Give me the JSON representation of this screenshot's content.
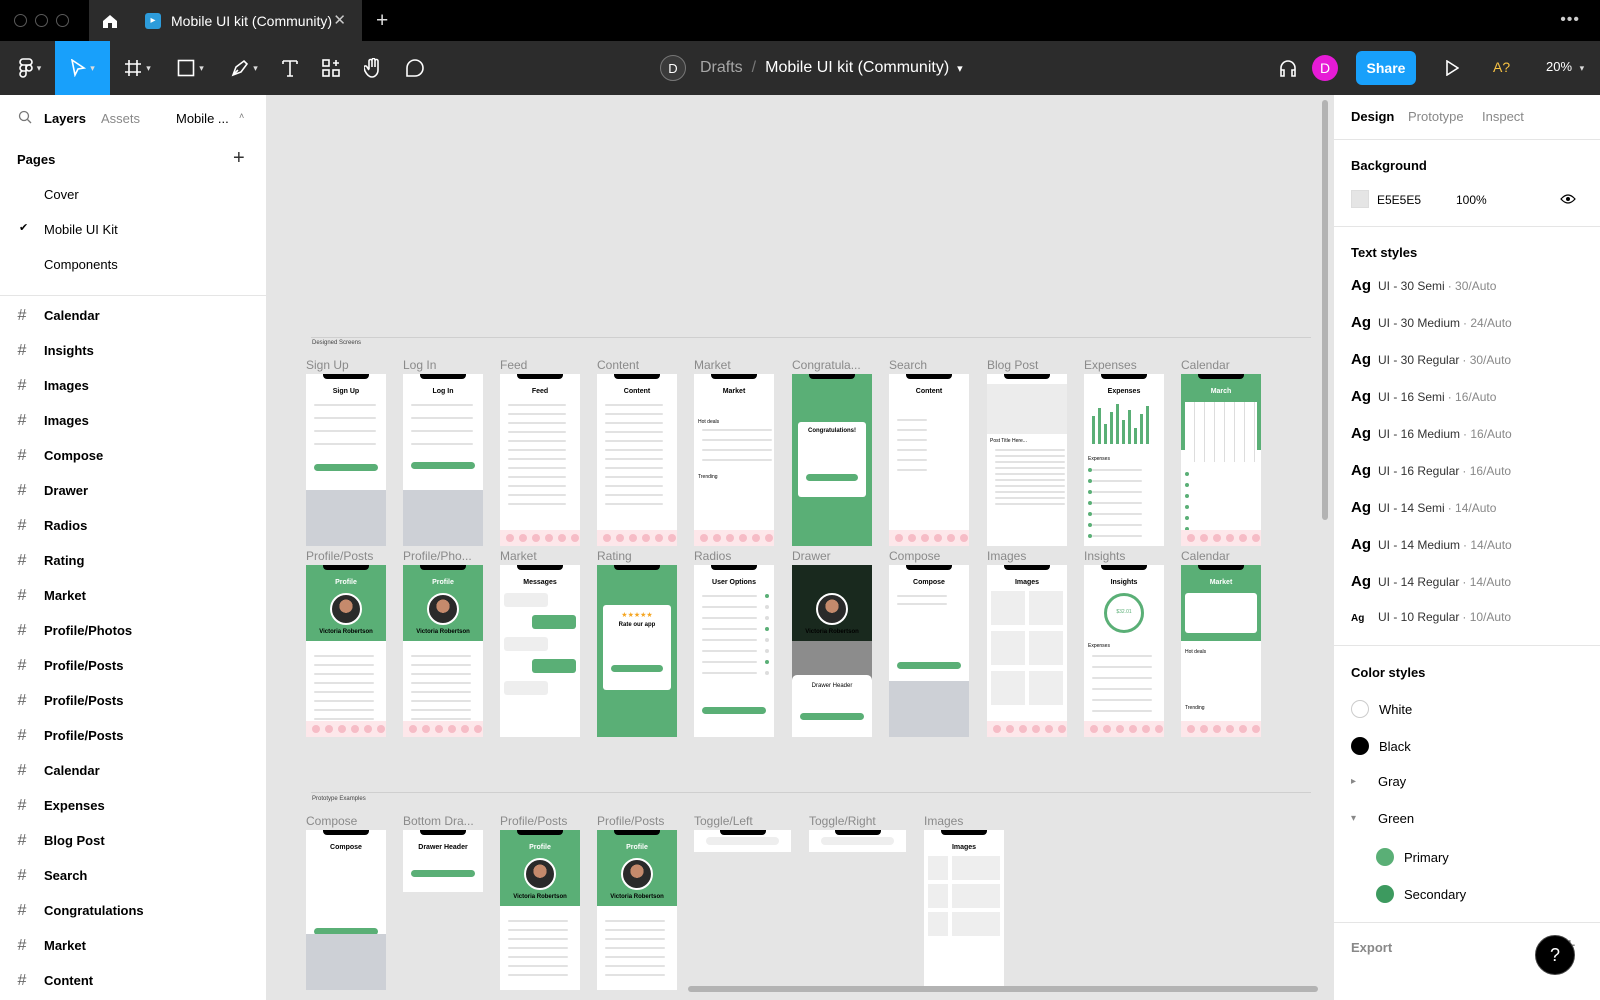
{
  "titlebar": {
    "tab_title": "Mobile UI kit (Community)",
    "new_tab": "+",
    "close": "✕"
  },
  "toolbar": {
    "breadcrumb_avatar": "D",
    "breadcrumb_drafts": "Drafts",
    "breadcrumb_sep": "/",
    "file_name": "Mobile UI kit (Community)",
    "user_initial": "D",
    "share_label": "Share",
    "a_label": "A?",
    "zoom": "20%"
  },
  "left_panel": {
    "tabs": {
      "layers": "Layers",
      "assets": "Assets",
      "page_select": "Mobile ..."
    },
    "pages_heading": "Pages",
    "pages": [
      "Cover",
      "Mobile UI Kit",
      "Components"
    ],
    "current_page": "Mobile UI Kit",
    "layers": [
      "Calendar",
      "Insights",
      "Images",
      "Images",
      "Compose",
      "Drawer",
      "Radios",
      "Rating",
      "Market",
      "Profile/Photos",
      "Profile/Posts",
      "Profile/Posts",
      "Profile/Posts",
      "Calendar",
      "Expenses",
      "Blog Post",
      "Search",
      "Congratulations",
      "Market",
      "Content"
    ]
  },
  "canvas": {
    "section1_label": "Designed Screens",
    "section2_label": "Prototype Examples",
    "row1": [
      "Sign Up",
      "Log In",
      "Feed",
      "Content",
      "Market",
      "Congratula...",
      "Search",
      "Blog Post",
      "Expenses",
      "Calendar"
    ],
    "row1_titles": [
      "Sign Up",
      "Log In",
      "Feed",
      "Content",
      "Market",
      "",
      "Content",
      "",
      "Expenses",
      "March"
    ],
    "row2": [
      "Profile/Posts",
      "Profile/Pho...",
      "Market",
      "Rating",
      "Radios",
      "Drawer",
      "Compose",
      "Images",
      "Insights",
      "Calendar"
    ],
    "row2_titles": [
      "Profile",
      "Profile",
      "Messages",
      "",
      "User Options",
      "Profile",
      "Compose",
      "Images",
      "Insights",
      "Market"
    ],
    "row3": [
      "Compose",
      "Bottom Dra...",
      "Profile/Posts",
      "Profile/Posts",
      "Toggle/Left",
      "Toggle/Right",
      "Images"
    ],
    "row3_titles": [
      "Compose",
      "Drawer Header",
      "Profile",
      "Profile",
      "",
      "",
      "Images"
    ],
    "congrats_text": "Congratulations!",
    "rate_text": "Rate our app",
    "stars": "★★★★★",
    "person_name": "Victoria Robertson",
    "blog_title": "Post Title Here...",
    "hot_deals": "Hot deals",
    "trending": "Trending",
    "expenses_label": "Expenses",
    "insight_value": "$32.01",
    "drawer_header": "Drawer Header"
  },
  "right_panel": {
    "tabs": {
      "design": "Design",
      "prototype": "Prototype",
      "inspect": "Inspect"
    },
    "background_heading": "Background",
    "bg_hex": "E5E5E5",
    "bg_opacity": "100%",
    "text_styles_heading": "Text styles",
    "text_styles": [
      {
        "ag": "Ag",
        "name": "UI - 30 Semi",
        "size": "· 30/Auto"
      },
      {
        "ag": "Ag",
        "name": "UI - 30 Medium",
        "size": "· 24/Auto"
      },
      {
        "ag": "Ag",
        "name": "UI - 30 Regular",
        "size": "· 30/Auto"
      },
      {
        "ag": "Ag",
        "name": "UI - 16 Semi",
        "size": "· 16/Auto"
      },
      {
        "ag": "Ag",
        "name": "UI - 16 Medium",
        "size": "· 16/Auto"
      },
      {
        "ag": "Ag",
        "name": "UI - 16 Regular",
        "size": "· 16/Auto"
      },
      {
        "ag": "Ag",
        "name": "UI - 14 Semi",
        "size": "· 14/Auto"
      },
      {
        "ag": "Ag",
        "name": "UI - 14 Medium",
        "size": "· 14/Auto"
      },
      {
        "ag": "Ag",
        "name": "UI - 14 Regular",
        "size": "· 14/Auto"
      },
      {
        "ag": "Ag",
        "name": "UI - 10 Regular",
        "size": "· 10/Auto"
      }
    ],
    "color_styles_heading": "Color styles",
    "color_styles": [
      {
        "name": "White",
        "color": "#ffffff"
      },
      {
        "name": "Black",
        "color": "#000000"
      },
      {
        "name": "Gray",
        "color": ""
      },
      {
        "name": "Green",
        "color": ""
      },
      {
        "name": "Primary",
        "color": "#5aaf76"
      },
      {
        "name": "Secondary",
        "color": "#3d9a5f"
      }
    ],
    "export_heading": "Export",
    "help": "?"
  },
  "colors": {
    "accent": "#18a0fb",
    "brand_green": "#5aaf76",
    "canvas_bg": "#e5e5e5",
    "user_avatar": "#e61bd6"
  }
}
